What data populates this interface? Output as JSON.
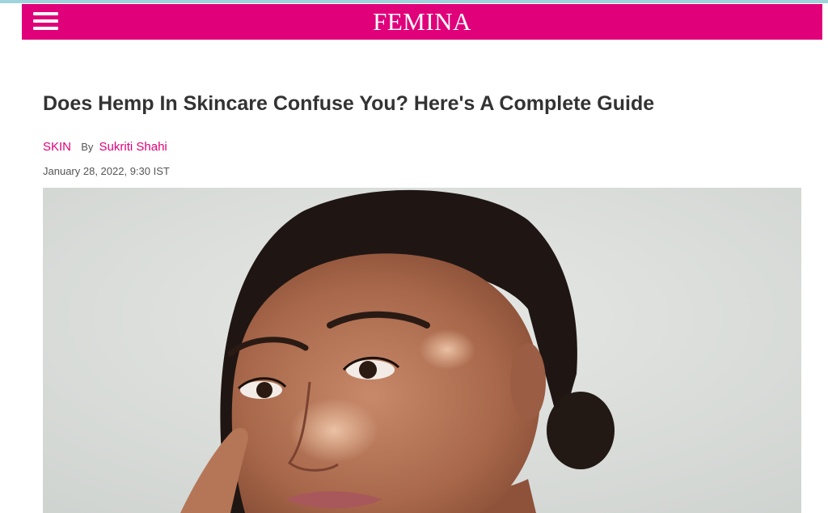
{
  "header": {
    "menu_icon": "hamburger-menu-icon",
    "logo_text": "FEMINA",
    "brand_color": "#e0007a"
  },
  "article": {
    "headline": "Does Hemp In Skincare Confuse You? Here's A Complete Guide",
    "category": "SKIN",
    "by_label": "By",
    "author": "Sukriti Shahi",
    "date": "January 28, 2022, 9:30 IST",
    "hero_image": "portrait-photo"
  }
}
